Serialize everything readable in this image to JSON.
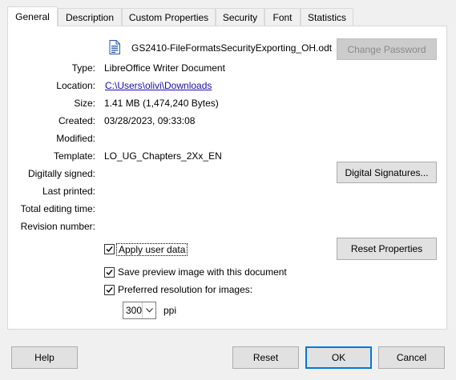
{
  "tabs": [
    {
      "label": "General",
      "active": true
    },
    {
      "label": "Description",
      "active": false
    },
    {
      "label": "Custom Properties",
      "active": false
    },
    {
      "label": "Security",
      "active": false
    },
    {
      "label": "Font",
      "active": false
    },
    {
      "label": "Statistics",
      "active": false
    }
  ],
  "file": {
    "icon": "writer-document-icon",
    "name": "GS2410-FileFormatsSecurityExporting_OH.odt"
  },
  "properties": {
    "type_label": "Type:",
    "type_value": "LibreOffice Writer Document",
    "location_label": "Location:",
    "location_value": "C:\\Users\\olivi\\Downloads",
    "size_label": "Size:",
    "size_value": "1.41 MB (1,474,240 Bytes)",
    "created_label": "Created:",
    "created_value": "03/28/2023, 09:33:08",
    "modified_label": "Modified:",
    "modified_value": "",
    "template_label": "Template:",
    "template_value": "LO_UG_Chapters_2Xx_EN",
    "signed_label": "Digitally signed:",
    "signed_value": "",
    "printed_label": "Last printed:",
    "printed_value": "",
    "editing_label": "Total editing time:",
    "editing_value": "",
    "revision_label": "Revision number:",
    "revision_value": ""
  },
  "buttons": {
    "change_password": "Change Password",
    "digital_signatures": "Digital Signatures...",
    "reset_properties": "Reset Properties",
    "help": "Help",
    "reset": "Reset",
    "ok": "OK",
    "cancel": "Cancel"
  },
  "options": {
    "apply_user_data": {
      "label": "Apply user data",
      "checked": true
    },
    "save_preview": {
      "label": "Save preview image with this document",
      "checked": true
    },
    "preferred_resolution": {
      "label": "Preferred resolution for images:",
      "checked": true
    }
  },
  "resolution": {
    "value": "300",
    "unit": "ppi"
  },
  "colors": {
    "link": "#1a0dab",
    "default_button_border": "#0078d7",
    "document_icon": "#1e5aa8"
  }
}
